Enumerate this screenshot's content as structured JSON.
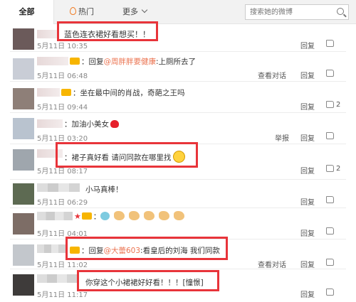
{
  "tabs": {
    "all": "全部",
    "hot": "热门",
    "more": "更多"
  },
  "search": {
    "placeholder": "搜索她的微博"
  },
  "comments": [
    {
      "content": "蓝色连衣裙好看想买！！",
      "time": "5月11日 10:35",
      "action": "",
      "like": ""
    },
    {
      "prefix": "：回复",
      "mention": "@周胖胖要健康",
      "content": ":上厕所去了",
      "time": "5月11日 06:48",
      "action": "查看对话",
      "like": ""
    },
    {
      "content": "：坐在最中间的肖战，奇葩之王吗",
      "time": "5月11日 09:44",
      "action": "",
      "like": "2"
    },
    {
      "content": "：加油小美女",
      "time": "5月11日 03:20",
      "action": "举报",
      "like": ""
    },
    {
      "content": "：裙子真好看 请问同款在哪里找",
      "time": "5月11日 08:17",
      "action": "",
      "like": "2"
    },
    {
      "content": "小马真棒！",
      "time": "5月11日 06:29",
      "action": "",
      "like": ""
    },
    {
      "content": "：",
      "time": "5月11日 04:01",
      "action": "",
      "like": ""
    },
    {
      "prefix": "：回复",
      "mention": "@大蕾603",
      "content": ":看皇后的刘海 我们同款",
      "time": "5月11日 11:02",
      "action": "查看对话",
      "like": ""
    },
    {
      "content": "你穿这个小裙裙好好看！！！[憧憬]",
      "time": "5月11日 11:17",
      "action": "",
      "like": ""
    }
  ],
  "labels": {
    "reply": "回复"
  },
  "colors": {
    "highlight_box": "#e8343a",
    "mention": "#eb7350"
  }
}
